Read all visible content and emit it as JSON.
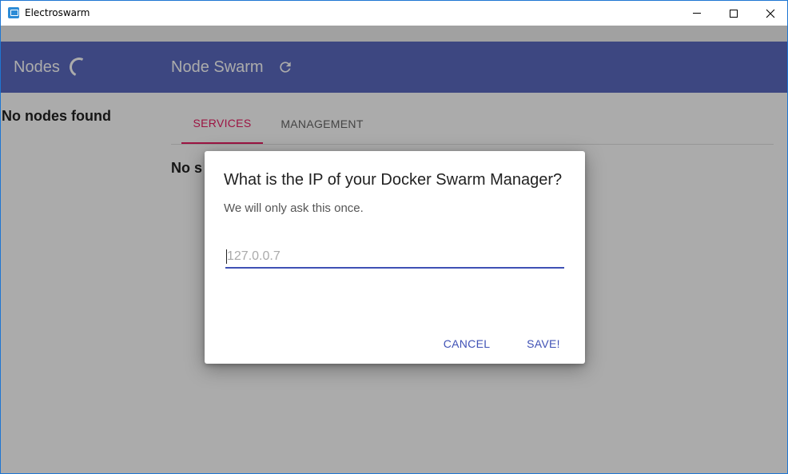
{
  "window": {
    "title": "Electroswarm",
    "minimize_icon": "minimize-icon",
    "maximize_icon": "maximize-icon",
    "close_icon": "close-icon"
  },
  "appbar": {
    "nodes_title": "Nodes",
    "swarm_title": "Node Swarm",
    "refresh_icon": "refresh-icon",
    "spinner_icon": "loading-spinner-icon",
    "color": "#5c6bc0"
  },
  "nodes_panel": {
    "empty_text": "No nodes found"
  },
  "tabs": [
    {
      "label": "SERVICES",
      "active": true
    },
    {
      "label": "MANAGEMENT",
      "active": false
    }
  ],
  "services_panel": {
    "empty_text": "No s"
  },
  "dialog": {
    "title": "What is the IP of your Docker Swarm Manager?",
    "body": "We will only ask this once.",
    "ip_placeholder": "127.0.0.7",
    "ip_value": "",
    "cancel_label": "CANCEL",
    "save_label": "SAVE!"
  },
  "colors": {
    "primary": "#3f51b5",
    "accent": "#e91e63"
  }
}
